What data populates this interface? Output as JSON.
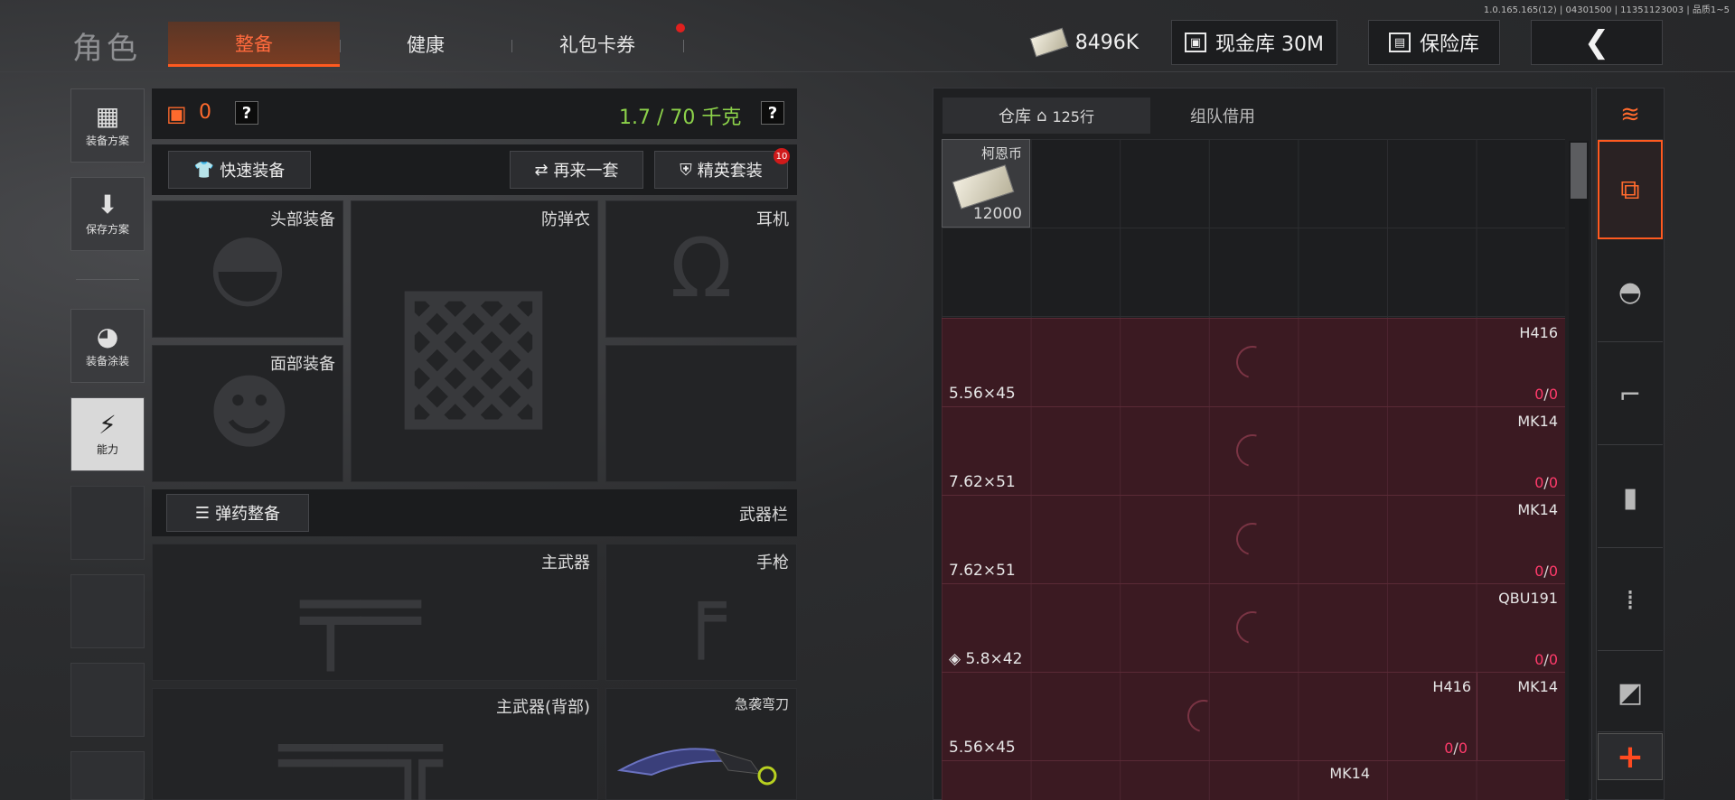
{
  "version": "1.0.165.165(12) | 04301500 | 11351123003 | 品质1~5",
  "header": {
    "title": "角色",
    "tabs": [
      {
        "label": "整备",
        "active": true
      },
      {
        "label": "健康",
        "active": false
      },
      {
        "label": "礼包卡券",
        "active": false,
        "dot": true
      }
    ],
    "money": "8496K",
    "cash_vault": "现金库 30M",
    "safe_box": "保险库"
  },
  "side_nav": [
    {
      "label": "装备方案",
      "icon": "vest-icon"
    },
    {
      "label": "保存方案",
      "icon": "download-icon"
    },
    {
      "label": "装备涂装",
      "icon": "helmet-skin-icon"
    },
    {
      "label": "能力",
      "icon": "ability-icon",
      "highlighted": true
    }
  ],
  "loadout": {
    "armor_level": "0",
    "weight": "1.7 / 70 千克",
    "help": "?",
    "quick_equip": "快速装备",
    "reroll": "再来一套",
    "elite_kit": "精英套装",
    "elite_badge": "10",
    "slots": {
      "head": "头部装备",
      "armor": "防弹衣",
      "headset": "耳机",
      "face": "面部装备"
    },
    "ammo_sort": "弹药整备",
    "weapon_bar": "武器栏",
    "weapon_slots": {
      "primary": "主武器",
      "pistol": "手枪",
      "primary_back": "主武器(背部)",
      "melee": "急袭弯刀"
    }
  },
  "warehouse": {
    "tab_label": "仓库",
    "rows": "125行",
    "team_borrow": "组队借用",
    "coin": {
      "name": "柯恩币",
      "amount": "12000"
    },
    "ammo_rows": [
      {
        "weapon": "H416",
        "caliber": "5.56×45",
        "count_a": "0",
        "count_b": "0"
      },
      {
        "weapon": "MK14",
        "caliber": "7.62×51",
        "count_a": "0",
        "count_b": "0"
      },
      {
        "weapon": "MK14",
        "caliber": "7.62×51",
        "count_a": "0",
        "count_b": "0"
      },
      {
        "weapon": "QBU191",
        "caliber": "5.8×42",
        "count_a": "0",
        "count_b": "0"
      },
      {
        "weapon": "H416",
        "weapon2": "MK14",
        "caliber": "5.56×45",
        "count_a": "0",
        "count_b": "0"
      },
      {
        "weapon": "MK14",
        "caliber": "",
        "count_a": "",
        "count_b": ""
      }
    ]
  },
  "rail": [
    {
      "icon": "layers-refresh-icon"
    },
    {
      "icon": "stack-down-icon",
      "selected": true
    },
    {
      "icon": "helmet-filter-icon"
    },
    {
      "icon": "rifle-filter-icon"
    },
    {
      "icon": "magazine-filter-icon"
    },
    {
      "icon": "bullet-filter-icon"
    },
    {
      "icon": "scope-filter-icon"
    }
  ],
  "add_label": "+"
}
